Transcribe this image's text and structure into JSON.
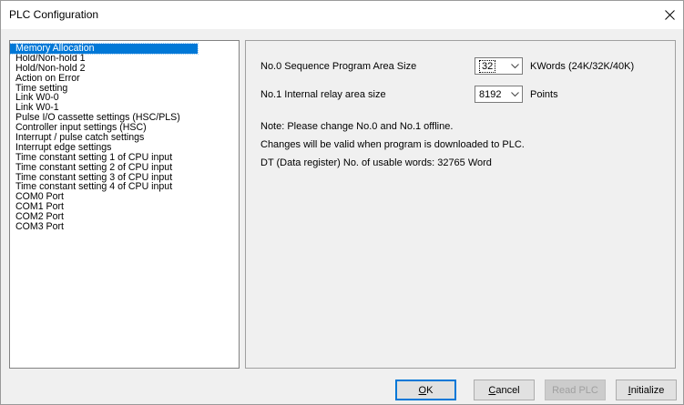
{
  "window": {
    "title": "PLC Configuration",
    "close_glyph": "✕"
  },
  "sidebar": {
    "items": [
      {
        "label": "Memory Allocation",
        "selected": true
      },
      {
        "label": "Hold/Non-hold 1"
      },
      {
        "label": "Hold/Non-hold 2"
      },
      {
        "label": "Action on Error"
      },
      {
        "label": "Time setting"
      },
      {
        "label": "Link W0-0"
      },
      {
        "label": "Link W0-1"
      },
      {
        "label": "Pulse I/O cassette settings (HSC/PLS)"
      },
      {
        "label": "Controller input settings (HSC)"
      },
      {
        "label": "Interrupt / pulse catch settings"
      },
      {
        "label": "Interrupt edge settings"
      },
      {
        "label": "Time constant setting 1 of CPU input"
      },
      {
        "label": "Time constant setting 2 of CPU input"
      },
      {
        "label": "Time constant setting 3 of CPU input"
      },
      {
        "label": "Time constant setting 4 of CPU input"
      },
      {
        "label": "COM0 Port"
      },
      {
        "label": "COM1 Port"
      },
      {
        "label": "COM2 Port"
      },
      {
        "label": "COM3 Port"
      }
    ]
  },
  "main": {
    "program_area": {
      "label": "No.0 Sequence Program Area Size",
      "value": "32",
      "unit": "KWords  (24K/32K/40K)"
    },
    "relay_area": {
      "label": "No.1 Internal relay area size",
      "value": "8192",
      "unit": "Points"
    },
    "notes": {
      "line1": "Note: Please change No.0 and No.1 offline.",
      "line2": "Changes will be valid when program is downloaded to PLC.",
      "line3": "DT (Data register) No. of usable words:   32765 Word"
    }
  },
  "buttons": {
    "ok": {
      "accel": "O",
      "rest": "K"
    },
    "cancel": {
      "accel": "C",
      "rest": "ancel"
    },
    "read_plc": {
      "label": "Read PLC"
    },
    "initialize": {
      "accel": "I",
      "rest": "nitialize"
    }
  },
  "colors": {
    "selection": "#0078d7",
    "window_bg": "#f0f0f0",
    "default_button_border": "#0078d7"
  },
  "icons": {
    "close": "close-icon",
    "dropdown": "chevron-down-icon"
  }
}
